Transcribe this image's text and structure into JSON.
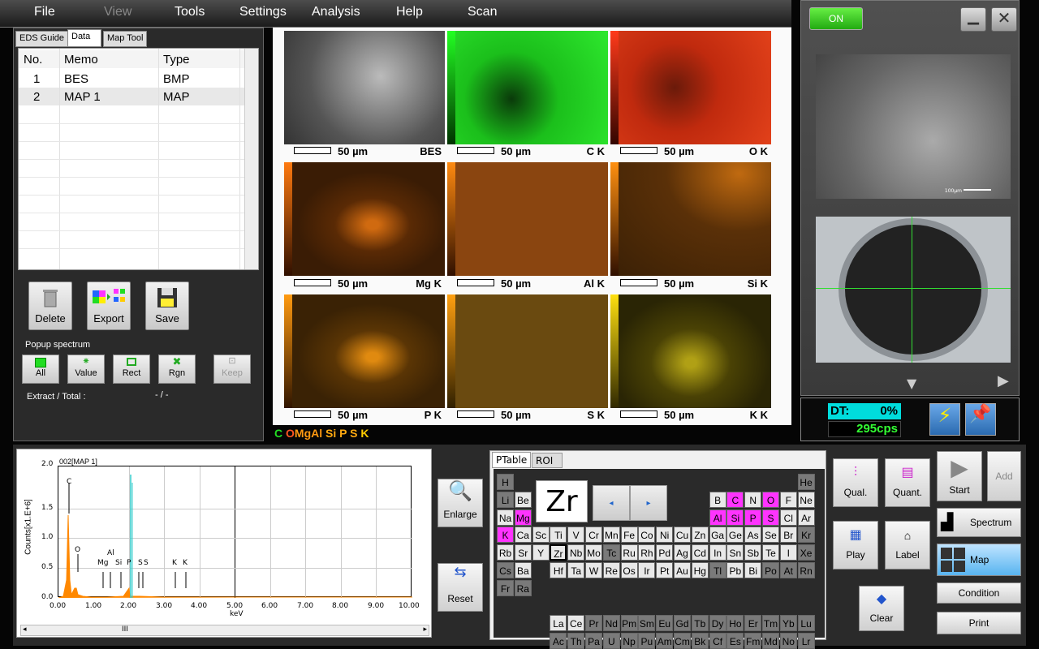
{
  "menu": {
    "file": "File",
    "view": "View",
    "tools": "Tools",
    "settings": "Settings",
    "analysis": "Analysis",
    "help": "Help",
    "scan": "Scan"
  },
  "left_tabs": {
    "eds_guide": "EDS Guide",
    "data": "Data",
    "map_tool": "Map Tool"
  },
  "table": {
    "headers": [
      "No.",
      "Memo",
      "Type"
    ],
    "rows": [
      {
        "no": "1",
        "memo": "BES",
        "type": "BMP"
      },
      {
        "no": "2",
        "memo": "MAP 1",
        "type": "MAP"
      }
    ]
  },
  "buttons": {
    "delete": "Delete",
    "export": "Export",
    "save": "Save"
  },
  "popup": {
    "title": "Popup spectrum",
    "all": "All",
    "value": "Value",
    "rect": "Rect",
    "rgn": "Rgn",
    "keep": "Keep",
    "extract_label": "Extract / Total :",
    "extract_value": "- / -"
  },
  "maps": [
    {
      "scale": "50 µm",
      "element": "BES"
    },
    {
      "scale": "50 µm",
      "element": "C K"
    },
    {
      "scale": "50 µm",
      "element": "O K"
    },
    {
      "scale": "50 µm",
      "element": "Mg K"
    },
    {
      "scale": "50 µm",
      "element": "Al K"
    },
    {
      "scale": "50 µm",
      "element": "Si K"
    },
    {
      "scale": "50 µm",
      "element": "P K"
    },
    {
      "scale": "50 µm",
      "element": "S K"
    },
    {
      "scale": "50 µm",
      "element": "K K"
    }
  ],
  "map_legend": [
    {
      "t": "C",
      "c": "#22dd22"
    },
    {
      "t": "O",
      "c": "#ff5522"
    },
    {
      "t": "Mg",
      "c": "#ff9911"
    },
    {
      "t": "Al",
      "c": "#ff9911"
    },
    {
      "t": "Si",
      "c": "#ffaa11"
    },
    {
      "t": "P",
      "c": "#ffaa11"
    },
    {
      "t": "S",
      "c": "#ffaa11"
    },
    {
      "t": "K",
      "c": "#ffcc00"
    }
  ],
  "right": {
    "on": "ON",
    "sem_scale": "100µm"
  },
  "status": {
    "dt_label": "DT:",
    "dt_value": "0%",
    "cps": "295cps"
  },
  "spectrum": {
    "title": "002[MAP 1]",
    "ylabel": "Counts[x1.E+6]",
    "xlabel": "keV",
    "yticks": [
      "2.0",
      "1.5",
      "1.0",
      "0.5",
      "0.0"
    ],
    "xticks": [
      "0.00",
      "1.00",
      "2.00",
      "3.00",
      "4.00",
      "5.00",
      "6.00",
      "7.00",
      "8.00",
      "9.00",
      "10.00"
    ],
    "peaks": [
      "C",
      "O",
      "Al",
      "Mg",
      "Si",
      "P",
      "S",
      "S",
      "K",
      "K"
    ],
    "scroll_thumb": "III"
  },
  "side_buttons": {
    "enlarge": "Enlarge",
    "reset": "Reset"
  },
  "ptable": {
    "tabs": [
      "PTable",
      "ROI"
    ],
    "selected": "Zr",
    "nav_prev": "◂",
    "nav_next": "▸"
  },
  "controls": {
    "qual": "Qual.",
    "quant": "Quant.",
    "start": "Start",
    "add": "Add",
    "spectrum": "Spectrum",
    "play": "Play",
    "label": "Label",
    "map": "Map",
    "condition": "Condition",
    "clear": "Clear",
    "print": "Print"
  }
}
